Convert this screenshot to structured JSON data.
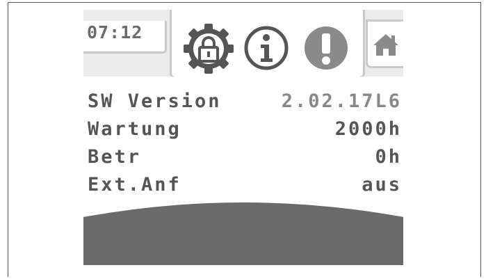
{
  "header": {
    "time": "07:12",
    "icons": [
      "settings-lock-icon",
      "info-icon",
      "alert-icon",
      "home-icon"
    ]
  },
  "info_rows": [
    {
      "label": "SW Version",
      "value": "2.02.17L6"
    },
    {
      "label": "Wartung",
      "value": "2000h"
    },
    {
      "label": "Betr",
      "value": "0h"
    },
    {
      "label": "Ext.Anf",
      "value": "aus"
    }
  ],
  "colors": {
    "screen_bg": "#ebebeb",
    "tab_border": "#c9c9c9",
    "text": "#555555",
    "bottom_bar": "#6a6a6a"
  }
}
